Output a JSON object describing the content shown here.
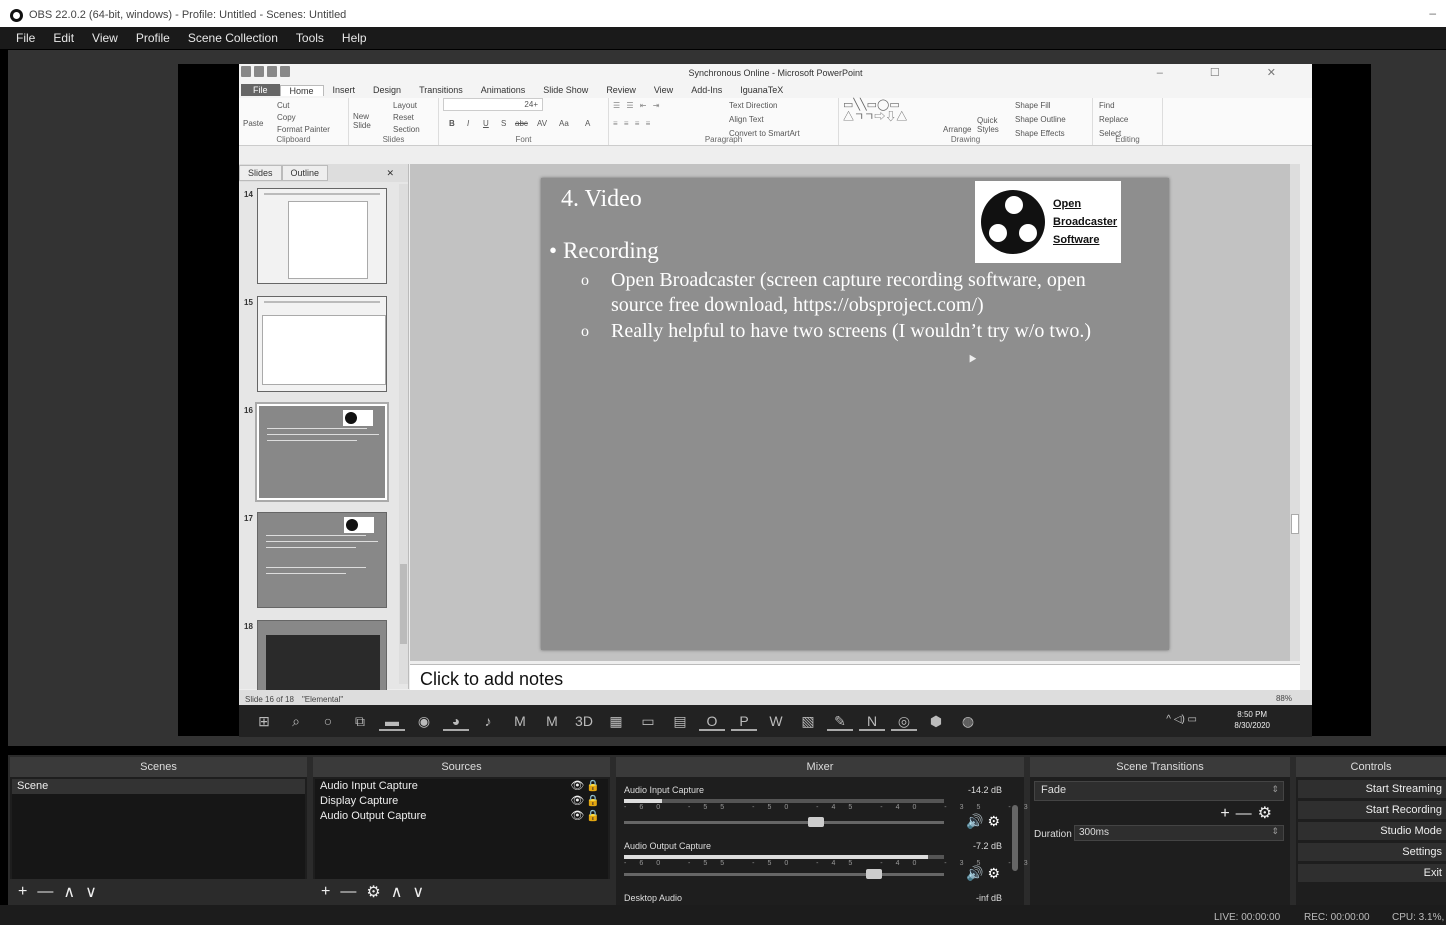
{
  "window": {
    "title": "OBS 22.0.2 (64-bit, windows) - Profile: Untitled - Scenes: Untitled",
    "minimize": "–"
  },
  "menu": [
    "File",
    "Edit",
    "View",
    "Profile",
    "Scene Collection",
    "Tools",
    "Help"
  ],
  "powerpoint": {
    "title": "Synchronous Online - Microsoft PowerPoint",
    "window_controls": "– ☐ ✕",
    "tabs": [
      "File",
      "Home",
      "Insert",
      "Design",
      "Transitions",
      "Animations",
      "Slide Show",
      "Review",
      "View",
      "Add-Ins",
      "IguanaTeX"
    ],
    "ribbon": {
      "clipboard": {
        "paste": "Paste",
        "cut": "Cut",
        "copy": "Copy",
        "format_painter": "Format Painter",
        "label": "Clipboard"
      },
      "slides": {
        "new_slide": "New Slide",
        "layout": "Layout",
        "reset": "Reset",
        "section": "Section",
        "label": "Slides"
      },
      "font": {
        "size": "24+",
        "bold": "B",
        "italic": "I",
        "underline": "U",
        "shadow": "S",
        "strike": "abc",
        "spacing": "AV",
        "case": "Aa",
        "color": "A",
        "label": "Font"
      },
      "paragraph": {
        "text_direction": "Text Direction",
        "align_text": "Align Text",
        "smartart": "Convert to SmartArt",
        "label": "Paragraph"
      },
      "drawing": {
        "arrange": "Arrange",
        "quick_styles": "Quick Styles",
        "shape_fill": "Shape Fill",
        "shape_outline": "Shape Outline",
        "shape_effects": "Shape Effects",
        "label": "Drawing"
      },
      "editing": {
        "find": "Find",
        "replace": "Replace",
        "select": "Select",
        "label": "Editing"
      }
    },
    "panel_tabs": [
      "Slides",
      "Outline"
    ],
    "panel_close": "✕",
    "thumbnails": [
      "14",
      "15",
      "16",
      "17",
      "18"
    ],
    "slide": {
      "heading": "4. Video",
      "bullet": "•",
      "bullet1": "Recording",
      "sub_bullet": "o",
      "sub1": "Open Broadcaster (screen capture recording software, open source free download, https://obsproject.com/)",
      "sub2": "Really helpful to have two screens (I wouldn’t try w/o two.)",
      "logo": {
        "line1": "Open",
        "line2": "Broadcaster",
        "line3": "Software"
      }
    },
    "notes": "Click to add notes",
    "status": {
      "slide": "Slide 16 of 18",
      "theme": "\"Elemental\"",
      "zoom": "88%"
    }
  },
  "taskbar": {
    "time": "8:50 PM",
    "date": "8/30/2020",
    "tray": "^ ◁) ▭"
  },
  "scenes": {
    "header": "Scenes",
    "items": [
      "Scene"
    ]
  },
  "sources": {
    "header": "Sources",
    "items": [
      "Audio Input Capture",
      "Display Capture",
      "Audio Output Capture"
    ]
  },
  "mixer": {
    "header": "Mixer",
    "tracks": [
      {
        "name": "Audio Input Capture",
        "db": "-14.2 dB",
        "level": 0.12,
        "volume": 0.6
      },
      {
        "name": "Audio Output Capture",
        "db": "-7.2 dB",
        "level": 0.95,
        "volume": 0.78
      },
      {
        "name": "Desktop Audio",
        "db": "-inf dB"
      }
    ],
    "ticks": "-60 -55 -50 -45 -40 -35 -30 -25 -20 -15 -10 -5 0"
  },
  "transitions": {
    "header": "Scene Transitions",
    "type": "Fade",
    "duration_label": "Duration",
    "duration": "300ms"
  },
  "controls": {
    "header": "Controls",
    "buttons": [
      "Start Streaming",
      "Start Recording",
      "Studio Mode",
      "Settings",
      "Exit"
    ]
  },
  "statusbar": {
    "live": "LIVE: 00:00:00",
    "rec": "REC: 00:00:00",
    "cpu": "CPU: 3.1%,"
  }
}
